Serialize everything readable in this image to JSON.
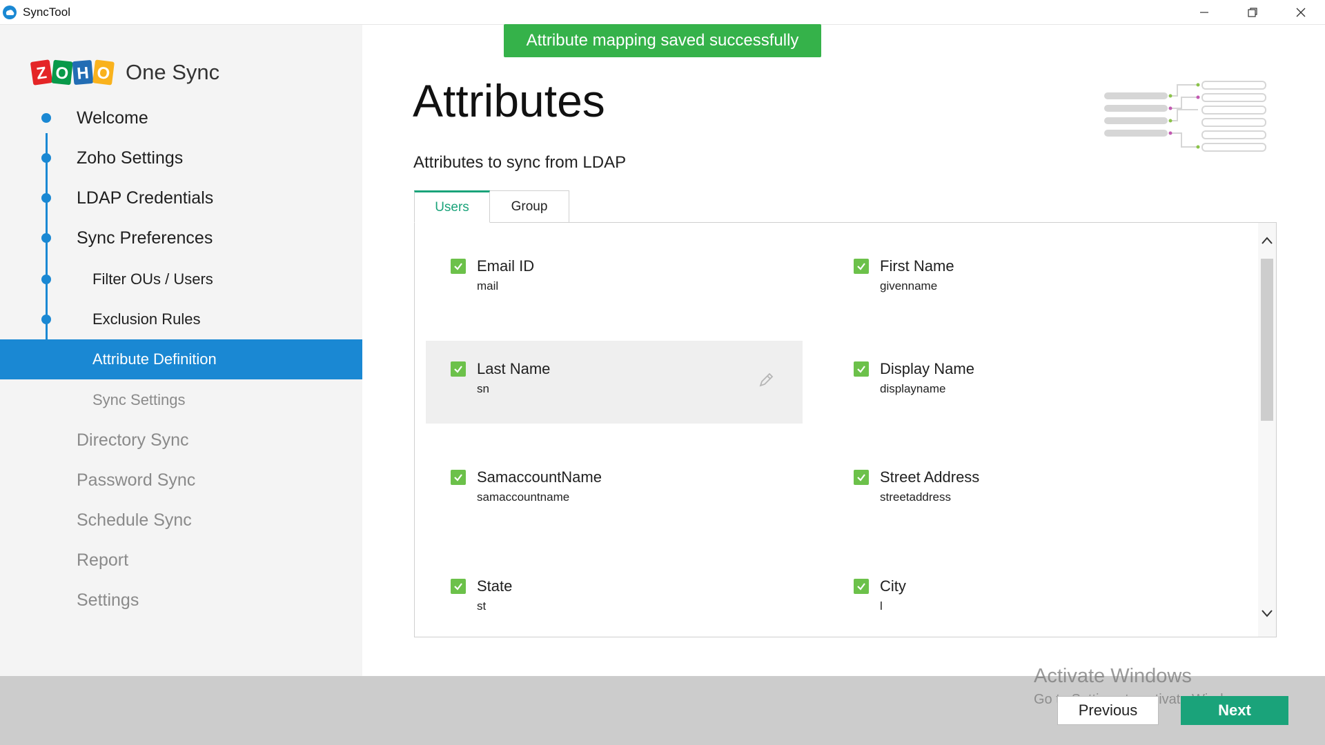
{
  "window": {
    "title": "SyncTool"
  },
  "brand": {
    "product_name": "One Sync",
    "logo_letters": [
      "Z",
      "O",
      "H",
      "O"
    ],
    "logo_colors": [
      "#e42527",
      "#089949",
      "#226db4",
      "#f9b21d"
    ]
  },
  "nav": [
    {
      "label": "Welcome",
      "level": "main",
      "state": "done"
    },
    {
      "label": "Zoho Settings",
      "level": "main",
      "state": "done"
    },
    {
      "label": "LDAP Credentials",
      "level": "main",
      "state": "done"
    },
    {
      "label": "Sync Preferences",
      "level": "main",
      "state": "done"
    },
    {
      "label": "Filter OUs / Users",
      "level": "sub",
      "state": "done"
    },
    {
      "label": "Exclusion Rules",
      "level": "sub",
      "state": "done"
    },
    {
      "label": "Attribute Definition",
      "level": "sub",
      "state": "active"
    },
    {
      "label": "Sync Settings",
      "level": "sub",
      "state": "pending"
    },
    {
      "label": "Directory Sync",
      "level": "main",
      "state": "pending"
    },
    {
      "label": "Password Sync",
      "level": "main",
      "state": "pending"
    },
    {
      "label": "Schedule Sync",
      "level": "main",
      "state": "pending"
    },
    {
      "label": "Report",
      "level": "main",
      "state": "pending"
    },
    {
      "label": "Settings",
      "level": "main",
      "state": "pending"
    }
  ],
  "toast": {
    "message": "Attribute mapping saved successfully",
    "color": "#35b24a"
  },
  "main": {
    "title": "Attributes",
    "subtitle": "Attributes to sync from LDAP",
    "tabs": [
      {
        "label": "Users",
        "active": true
      },
      {
        "label": "Group",
        "active": false
      }
    ],
    "attributes": [
      {
        "name": "Email ID",
        "ldap": "mail",
        "checked": true
      },
      {
        "name": "First Name",
        "ldap": "givenname",
        "checked": true
      },
      {
        "name": "Last Name",
        "ldap": "sn",
        "checked": true,
        "hovered": true
      },
      {
        "name": "Display Name",
        "ldap": "displayname",
        "checked": true
      },
      {
        "name": "SamaccountName",
        "ldap": "samaccountname",
        "checked": true
      },
      {
        "name": "Street Address",
        "ldap": "streetaddress",
        "checked": true
      },
      {
        "name": "State",
        "ldap": "st",
        "checked": true
      },
      {
        "name": "City",
        "ldap": "l",
        "checked": true
      }
    ]
  },
  "footer": {
    "previous_label": "Previous",
    "next_label": "Next"
  },
  "watermark": {
    "line1": "Activate Windows",
    "line2": "Go to Settings to activate Windows."
  },
  "colors": {
    "accent_blue": "#1a88d3",
    "accent_green": "#1aa37a",
    "checkbox_green": "#6cc14a"
  }
}
